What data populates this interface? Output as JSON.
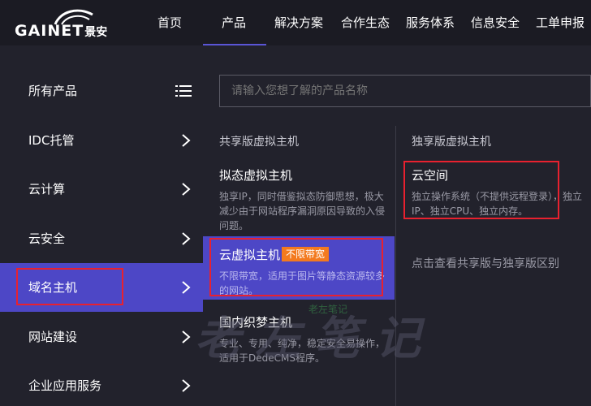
{
  "logo": {
    "text": "GAINET",
    "cn": "景安"
  },
  "nav": {
    "items": [
      "首页",
      "产品",
      "解决方案",
      "合作生态",
      "服务体系",
      "信息安全",
      "工单申报"
    ]
  },
  "sidebar": {
    "header": "所有产品",
    "items": [
      {
        "label": "IDC托管"
      },
      {
        "label": "云计算"
      },
      {
        "label": "云安全"
      },
      {
        "label": "域名主机"
      },
      {
        "label": "网站建设"
      },
      {
        "label": "企业应用服务"
      }
    ]
  },
  "search": {
    "placeholder": "请输入您想了解的产品名称"
  },
  "shared": {
    "title": "共享版虚拟主机",
    "products": [
      {
        "name": "拟态虚拟主机",
        "desc": "独享IP，同时借鉴拟态防御思想，极大减少由于网站程序漏洞原因导致的入侵问题。"
      },
      {
        "name": "云虚拟主机",
        "badge": "不限带宽",
        "desc": "不限带宽，适用于图片等静态资源较多的网站。"
      },
      {
        "name": "国内织梦主机",
        "desc": "专业、专用、纯净，稳定安全易操作，适用于DedeCMS程序。"
      }
    ]
  },
  "dedicated": {
    "title": "独享版虚拟主机",
    "products": [
      {
        "name": "云空间",
        "desc": "独立操作系统（不提供远程登录），独立IP、独立CPU、独立内存。"
      }
    ],
    "compare_link": "点击查看共享版与独享版区别"
  },
  "watermark": {
    "text": "老左笔记",
    "small": "老左笔记"
  },
  "colors": {
    "accent": "#4d47c6",
    "highlight": "#e8212f",
    "badge": "#f37a1f"
  }
}
